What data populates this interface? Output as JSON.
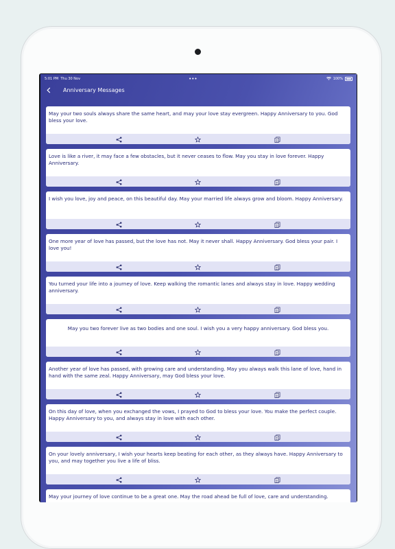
{
  "status": {
    "time": "5:01 PM",
    "date": "Thu 30 Nov",
    "dots": "•••",
    "battery": "100%"
  },
  "nav": {
    "title": "Anniversary Messages"
  },
  "messages": [
    "May your two souls always share the same heart, and may your love stay evergreen. Happy Anniversary to you. God bless your love.",
    "Love is like a river, it may face a few obstacles, but it never ceases to flow. May you stay in love forever. Happy Anniversary.",
    "I wish you love, joy and peace, on this beautiful day. May your married life always grow and bloom. Happy Anniversary.",
    "One more year of love has passed, but the love has not. May it never shall. Happy Anniversary. God bless your pair. I love you!",
    "You turned your life into a journey of love. Keep walking the romantic lanes and always stay in love. Happy wedding anniversary.",
    "May you two forever live as two bodies and one soul. I wish you a very happy anniversary. God bless you.",
    "Another year of love has passed, with growing care and understanding. May you always walk this lane of love, hand in hand with the same zeal. Happy Anniversary, may God bless your love.",
    "On this day of love, when you exchanged the vows, I prayed to God to bless your love. You make the perfect couple. Happy Anniversary to you, and always stay in love with each other.",
    "On your lovely anniversary, I wish your hearts keep beating for each other, as they always have. Happy Anniversary to you, and may together you live a life of bliss.",
    "May your journey of love continue to be a great one. May the road ahead be full of love, care and understanding."
  ],
  "icons": {
    "share": "share-icon",
    "favorite": "star-icon",
    "copy": "copy-icon",
    "back": "chevron-left-icon"
  },
  "colors": {
    "accent": "#3a3f9a",
    "text": "#272a77",
    "action_bar": "#e2e3f5"
  }
}
